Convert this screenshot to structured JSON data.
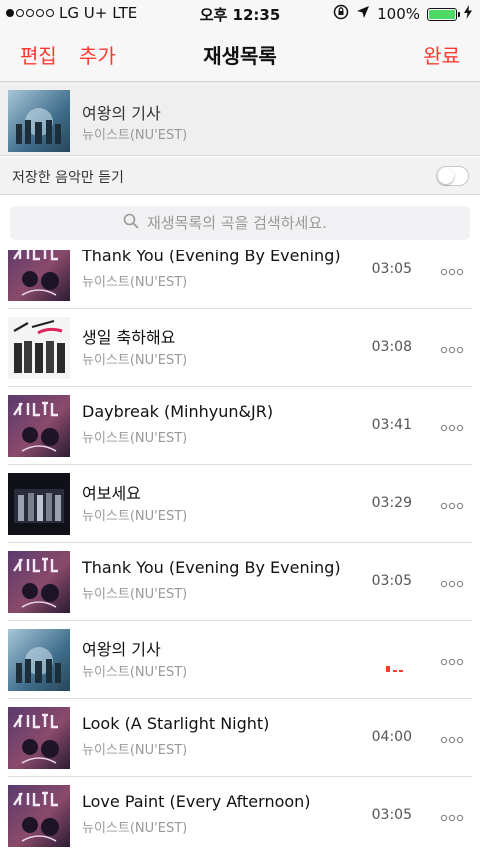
{
  "status": {
    "carrier": "LG U+",
    "network": "LTE",
    "time": "오후 12:35",
    "battery": "100%"
  },
  "nav": {
    "edit": "편집",
    "add": "추가",
    "title": "재생목록",
    "done": "완료"
  },
  "now_playing": {
    "title": "여왕의 기사",
    "artist": "뉴이스트(NU'EST)"
  },
  "filter": {
    "label": "저장한 음악만 듣기",
    "enabled": false
  },
  "search": {
    "placeholder": "재생목록의 곡을 검색하세요."
  },
  "songs": [
    {
      "title": "Thank You (Evening By Evening)",
      "artist": "뉴이스트(NU'EST)",
      "duration": "03:05",
      "cover": "nuest-purple-cover"
    },
    {
      "title": "생일 축하해요",
      "artist": "뉴이스트(NU'EST)",
      "duration": "03:08",
      "cover": "nuest-action-cover"
    },
    {
      "title": "Daybreak (Minhyun&JR)",
      "artist": "뉴이스트(NU'EST)",
      "duration": "03:41",
      "cover": "nuest-purple-cover"
    },
    {
      "title": "여보세요",
      "artist": "뉴이스트(NU'EST)",
      "duration": "03:29",
      "cover": "nuest-dark-cover"
    },
    {
      "title": "Thank You (Evening By Evening)",
      "artist": "뉴이스트(NU'EST)",
      "duration": "03:05",
      "cover": "nuest-purple-cover"
    },
    {
      "title": "여왕의 기사",
      "artist": "뉴이스트(NU'EST)",
      "duration": "",
      "cover": "nuest-blue-cover",
      "playing": true
    },
    {
      "title": "Look (A Starlight Night)",
      "artist": "뉴이스트(NU'EST)",
      "duration": "04:00",
      "cover": "nuest-purple-cover"
    },
    {
      "title": "Love Paint (Every Afternoon)",
      "artist": "뉴이스트(NU'EST)",
      "duration": "03:05",
      "cover": "nuest-purple-cover"
    }
  ],
  "colors": {
    "accent": "#ff3b30",
    "battery": "#4cd964",
    "secondary_text": "#999999"
  },
  "icons": [
    "signal-dots-icon",
    "orientation-lock-icon",
    "location-arrow-icon",
    "battery-icon",
    "charging-bolt-icon",
    "search-icon",
    "more-icon",
    "now-playing-equalizer-icon"
  ]
}
